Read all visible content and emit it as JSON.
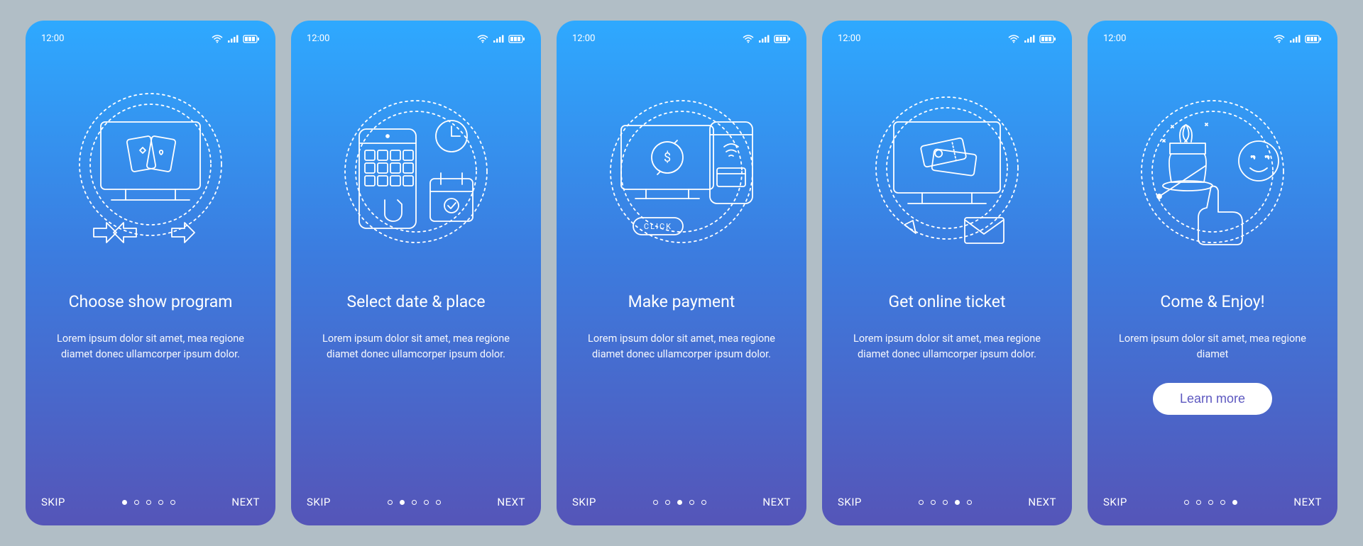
{
  "status": {
    "time": "12:00"
  },
  "nav": {
    "skip": "SKIP",
    "next": "NEXT"
  },
  "screens": [
    {
      "title": "Choose show program",
      "body": "Lorem ipsum dolor sit amet, mea regione diamet donec ullamcorper ipsum dolor.",
      "activeDot": 0
    },
    {
      "title": "Select date & place",
      "body": "Lorem ipsum dolor sit amet, mea regione diamet donec ullamcorper ipsum dolor.",
      "activeDot": 1
    },
    {
      "title": "Make payment",
      "body": "Lorem ipsum dolor sit amet, mea regione diamet donec ullamcorper ipsum dolor.",
      "activeDot": 2
    },
    {
      "title": "Get online ticket",
      "body": "Lorem ipsum dolor sit amet, mea regione diamet donec ullamcorper ipsum dolor.",
      "activeDot": 3
    },
    {
      "title": "Come & Enjoy!",
      "body": "Lorem ipsum dolor sit amet, mea regione diamet",
      "activeDot": 4,
      "cta": "Learn more"
    }
  ]
}
